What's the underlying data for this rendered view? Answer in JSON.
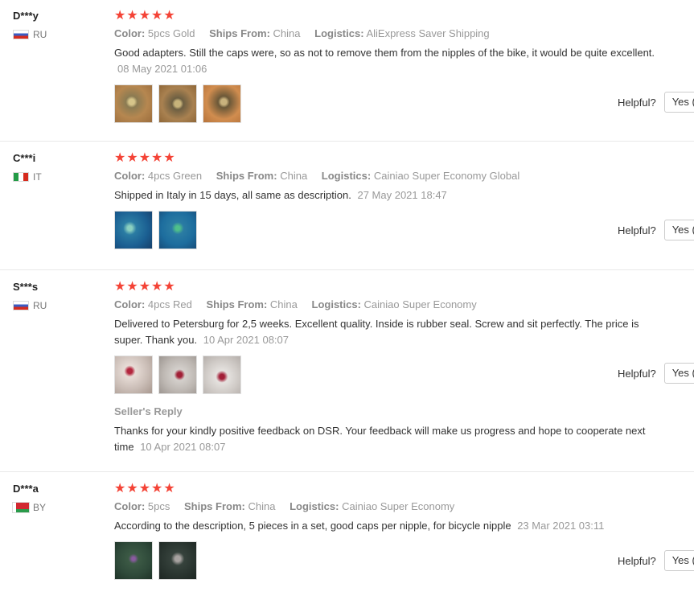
{
  "reviews": [
    {
      "user": "D***y",
      "country": "RU",
      "stars": "★★★★★",
      "color_label": "Color:",
      "color_value": "5pcs Gold",
      "ships_label": "Ships From:",
      "ships_value": "China",
      "logistics_label": "Logistics:",
      "logistics_value": "AliExpress Saver Shipping",
      "text": "Good adapters. Still the caps were, so as not to remove them from the nipples of the bike, it would be quite excellent.",
      "date": "08 May 2021 01:06",
      "helpful_label": "Helpful?",
      "yes_label": "Yes (",
      "rating": 5
    },
    {
      "user": "C***i",
      "country": "IT",
      "stars": "★★★★★",
      "color_label": "Color:",
      "color_value": "4pcs Green",
      "ships_label": "Ships From:",
      "ships_value": "China",
      "logistics_label": "Logistics:",
      "logistics_value": "Cainiao Super Economy Global",
      "text": "Shipped in Italy in 15 days, all same as description.",
      "date": "27 May 2021 18:47",
      "helpful_label": "Helpful?",
      "yes_label": "Yes (",
      "rating": 5
    },
    {
      "user": "S***s",
      "country": "RU",
      "stars": "★★★★★",
      "color_label": "Color:",
      "color_value": "4pcs Red",
      "ships_label": "Ships From:",
      "ships_value": "China",
      "logistics_label": "Logistics:",
      "logistics_value": "Cainiao Super Economy",
      "text": "Delivered to Petersburg for 2,5 weeks. Excellent quality. Inside is rubber seal. Screw and sit perfectly. The price is super. Thank you.",
      "date": "10 Apr 2021 08:07",
      "helpful_label": "Helpful?",
      "yes_label": "Yes (",
      "seller_reply_title": "Seller's Reply",
      "seller_reply_text": "Thanks for your kindly positive feedback on DSR. Your feedback will make us progress and hope to cooperate next time",
      "seller_reply_date": "10 Apr 2021 08:07",
      "rating": 5
    },
    {
      "user": "D***a",
      "country": "BY",
      "stars": "★★★★★",
      "color_label": "Color:",
      "color_value": "5pcs",
      "ships_label": "Ships From:",
      "ships_value": "China",
      "logistics_label": "Logistics:",
      "logistics_value": "Cainiao Super Economy",
      "text": "According to the description, 5 pieces in a set, good caps per nipple, for bicycle nipple",
      "date": "23 Mar 2021 03:11",
      "helpful_label": "Helpful?",
      "yes_label": "Yes (",
      "rating": 5
    }
  ],
  "colors": {
    "star": "#f44336",
    "meta_text": "#999999",
    "body_text": "#333333"
  }
}
